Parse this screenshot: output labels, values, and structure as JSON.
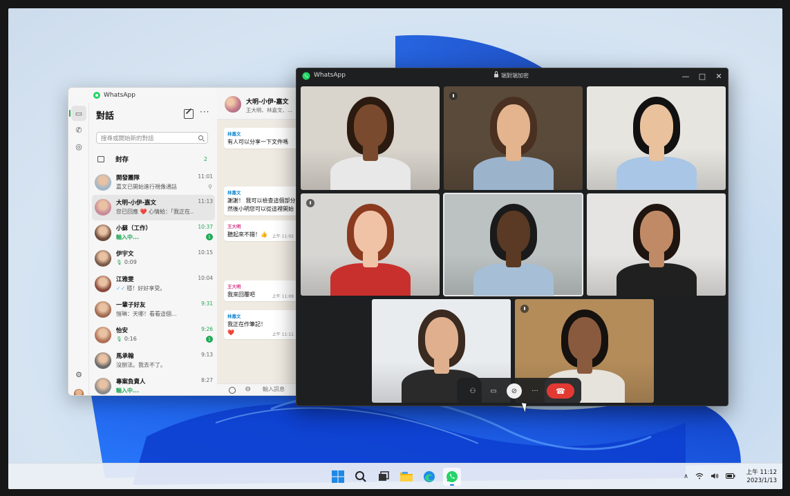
{
  "chat_window": {
    "app_title": "WhatsApp",
    "list": {
      "title": "對話",
      "search_placeholder": "搜尋或開始新的對話",
      "archived": {
        "label": "封存",
        "count": "2"
      },
      "chats": [
        {
          "name": "開發團隊",
          "preview": "嘉文已開始進行視像通話",
          "time": "11:01",
          "pinned": true,
          "avatar_color": "#9fb7c9"
        },
        {
          "name": "大明-小伊-嘉文",
          "preview": "您已回應 ❤️ 心情給：「我正在...",
          "time": "11:13",
          "selected": true,
          "avatar_color": "#c88a9a"
        },
        {
          "name": "小蘇（工作）",
          "preview": "輸入中...",
          "time": "10:37",
          "typing": true,
          "unread": "1",
          "avatar_color": "#6b4a3a"
        },
        {
          "name": "伊宇文",
          "preview": "0:09",
          "time": "10:15",
          "voice": true,
          "avatar_color": "#7a5a48"
        },
        {
          "name": "江雅雯",
          "preview": "穩！好好享受。",
          "time": "10:04",
          "ticks": true,
          "avatar_color": "#8a4a3a"
        },
        {
          "name": "一輩子好友",
          "preview": "愷琳：天哪！看看這個...",
          "time": "9:31",
          "time_unread": true,
          "avatar_color": "#a06a50"
        },
        {
          "name": "怡安",
          "preview": "0:16",
          "time": "9:26",
          "voice": true,
          "unread": "1",
          "time_unread": true,
          "avatar_color": "#b07058"
        },
        {
          "name": "馬承翰",
          "preview": "沒辦法。我去不了。",
          "time": "9:13",
          "avatar_color": "#6a6a6a"
        },
        {
          "name": "專案負責人",
          "preview": "輸入中...",
          "time": "8:27",
          "typing": true,
          "avatar_color": "#8a8a8a"
        }
      ]
    },
    "conversation": {
      "title": "大明-小伊-嘉文",
      "subtitle": "王大明、林嘉文、...",
      "messages": [
        {
          "author": "林嘉文",
          "text": "有人可以分享一下文件嗎",
          "time": "",
          "author_color": "#1d8ccf"
        },
        {
          "author": "林嘉文",
          "text": "謝謝！ 我可以檢查這個部分\n然後小明您可以從這裡開始",
          "time": "",
          "author_color": "#1d8ccf"
        },
        {
          "author": "王大明",
          "text": "聽起來不錯！👍",
          "time": "上午 11:02",
          "author_color": "#d63d8d"
        },
        {
          "author": "王大明",
          "text": "我來回覆吧",
          "time": "上午 11:09",
          "author_color": "#d63d8d"
        },
        {
          "author": "林嘉文",
          "text": "我正在作筆記！\n❤️",
          "time": "上午 11:11",
          "author_color": "#1d8ccf"
        }
      ],
      "input_placeholder": "輸入訊息"
    }
  },
  "call_window": {
    "app_title": "WhatsApp",
    "encryption": "端對端加密",
    "participants": [
      {
        "skin": "#7a4a2e",
        "hair": "#2b1a10",
        "shirt": "#e8e8e8",
        "bg": "#d9d4cc",
        "muted": false
      },
      {
        "skin": "#e4b48e",
        "hair": "#4a3020",
        "shirt": "#9bb4cc",
        "bg": "#5a4a3a",
        "muted": true
      },
      {
        "skin": "#e9c19c",
        "hair": "#111111",
        "shirt": "#a9c6e6",
        "bg": "#e7e5e0",
        "muted": false
      },
      {
        "skin": "#f0c2a6",
        "hair": "#8a3a1e",
        "shirt": "#c8302e",
        "bg": "#d7d6d3",
        "muted": true
      },
      {
        "skin": "#5a3a24",
        "hair": "#1a1a1a",
        "shirt": "#a6bfd6",
        "bg": "#bcc2c2",
        "muted": false,
        "speaking": true
      },
      {
        "skin": "#c08a66",
        "hair": "#1e1410",
        "shirt": "#202020",
        "bg": "#e6e4e2",
        "muted": false
      },
      {
        "skin": "#e0b08e",
        "hair": "#3a2a20",
        "shirt": "#2a2a2a",
        "bg": "#e9ecef",
        "muted": false
      },
      {
        "skin": "#8a5a3e",
        "hair": "#15110e",
        "shirt": "#e6e2dc",
        "bg": "#b48c5a",
        "muted": true
      }
    ]
  },
  "taskbar": {
    "clock_time": "上午 11:12",
    "clock_date": "2023/1/13"
  },
  "icons": {
    "rail": [
      "chat-icon",
      "phone-icon",
      "status-icon",
      "settings-icon"
    ],
    "taskbar": [
      "windows-start-icon",
      "search-icon",
      "task-view-icon",
      "file-explorer-icon",
      "edge-icon",
      "whatsapp-icon"
    ],
    "tray": [
      "chevron-up-icon",
      "wifi-icon",
      "volume-icon",
      "battery-icon"
    ],
    "call_controls": [
      "participants-icon",
      "video-icon",
      "mic-muted-icon",
      "more-icon",
      "end-call-icon"
    ]
  },
  "colors": {
    "whatsapp_green": "#25d366",
    "accent_green": "#1fa855",
    "end_call_red": "#e23a33"
  }
}
